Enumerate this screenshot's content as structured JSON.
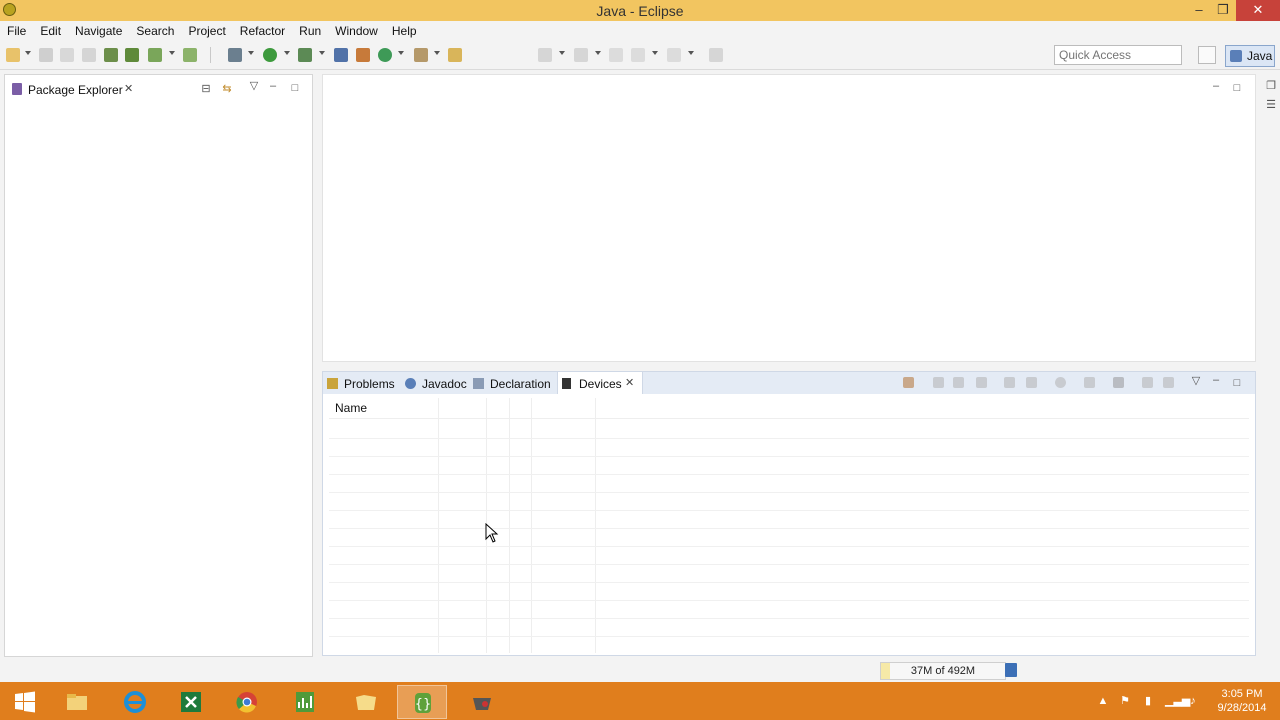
{
  "window": {
    "title": "Java - Eclipse",
    "controls": {
      "minimize": "–",
      "restore": "❐",
      "close": "✕"
    }
  },
  "menu": [
    "File",
    "Edit",
    "Navigate",
    "Search",
    "Project",
    "Refactor",
    "Run",
    "Window",
    "Help"
  ],
  "toolbar": {
    "quick_access_placeholder": "Quick Access",
    "perspective_label": "Java"
  },
  "package_explorer": {
    "tab_label": "Package Explorer",
    "close_glyph": "✕"
  },
  "bottom_panel": {
    "tabs": [
      {
        "label": "Problems",
        "icon": "problems-icon",
        "active": false
      },
      {
        "label": "Javadoc",
        "icon": "javadoc-icon",
        "active": false
      },
      {
        "label": "Declaration",
        "icon": "declaration-icon",
        "active": false
      },
      {
        "label": "Devices",
        "icon": "devices-icon",
        "active": true
      }
    ],
    "close_glyph": "✕",
    "devices_table": {
      "columns": [
        "Name",
        "",
        "",
        "",
        ""
      ],
      "rows": []
    }
  },
  "status": {
    "heap_label": "37M of 492M",
    "heap_used_mb": 37,
    "heap_total_mb": 492
  },
  "taskbar": {
    "apps": [
      "start-icon",
      "file-explorer-icon",
      "internet-explorer-icon",
      "excel-icon",
      "chrome-icon",
      "monitor-icon",
      "folder-icon",
      "eclipse-icon",
      "android-tool-icon"
    ],
    "clock_time": "3:05 PM",
    "clock_date": "9/28/2014"
  },
  "colors": {
    "titlebar": "#f2c560",
    "taskbar": "#e07e1d",
    "panel_tab_bg": "#e4ebf5"
  }
}
